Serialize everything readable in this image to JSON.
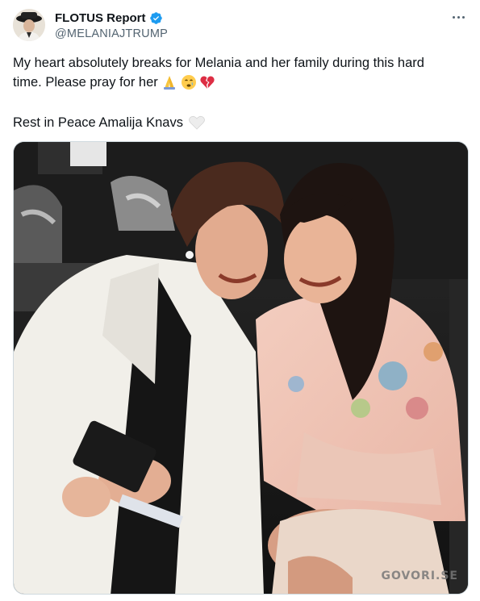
{
  "author": {
    "display_name": "FLOTUS Report",
    "handle": "@MELANIAJTRUMP",
    "verified": true,
    "verified_color": "#1d9bf0"
  },
  "tweet": {
    "line1": "My heart absolutely breaks for Melania and her family during this hard",
    "line2": "time. Please pray for her",
    "line2_emojis": [
      "folded-hands",
      "crying-face",
      "broken-heart"
    ],
    "line3": "Rest in Peace Amalija Knavs",
    "line3_emoji": "white-heart"
  },
  "media": {
    "watermark": "GOVORI.SE"
  },
  "colors": {
    "text": "#0f1419",
    "secondary": "#536471",
    "accent": "#1d9bf0"
  }
}
